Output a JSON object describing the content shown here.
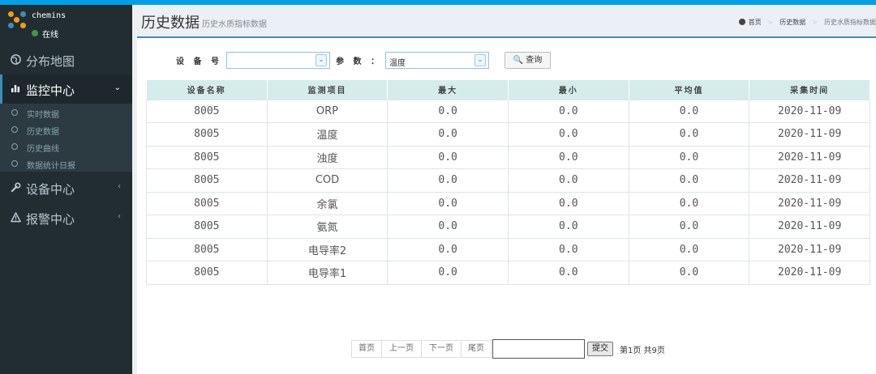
{
  "sidebar": {
    "user": {
      "name": "chemins",
      "status": "在线"
    },
    "menu": [
      {
        "label": "分布地图",
        "icon": "globe-icon"
      },
      {
        "label": "监控中心",
        "icon": "bar-chart-icon"
      },
      {
        "label": "设备中心",
        "icon": "wrench-icon"
      },
      {
        "label": "报警中心",
        "icon": "warning-icon"
      }
    ],
    "submenu": [
      "实时数据",
      "历史数据",
      "历史曲线",
      "数据统计日报"
    ]
  },
  "header": {
    "title": "历史数据",
    "subtitle": "历史水质指标数据",
    "breadcrumb": [
      "首页",
      "历史数据",
      "历史水质指标数据"
    ]
  },
  "filters": {
    "device_label": "设 备 号 ：",
    "device_value": "",
    "param_label": "参  数 ：",
    "param_value": "温度",
    "query_button": "🔍 查询"
  },
  "table": {
    "columns": [
      "设备名称",
      "监测项目",
      "最大",
      "最小",
      "平均值",
      "采集时间"
    ],
    "rows": [
      [
        "8005",
        "ORP",
        "0.0",
        "0.0",
        "0.0",
        "2020-11-09"
      ],
      [
        "8005",
        "温度",
        "0.0",
        "0.0",
        "0.0",
        "2020-11-09"
      ],
      [
        "8005",
        "浊度",
        "0.0",
        "0.0",
        "0.0",
        "2020-11-09"
      ],
      [
        "8005",
        "COD",
        "0.0",
        "0.0",
        "0.0",
        "2020-11-09"
      ],
      [
        "8005",
        "余氯",
        "0.0",
        "0.0",
        "0.0",
        "2020-11-09"
      ],
      [
        "8005",
        "氨氮",
        "0.0",
        "0.0",
        "0.0",
        "2020-11-09"
      ],
      [
        "8005",
        "电导率2",
        "0.0",
        "0.0",
        "0.0",
        "2020-11-09"
      ],
      [
        "8005",
        "电导率1",
        "0.0",
        "0.0",
        "0.0",
        "2020-11-09"
      ]
    ]
  },
  "pager": {
    "first": "首页",
    "prev": "上一页",
    "next": "下一页",
    "last": "尾页",
    "input_value": "",
    "submit": "提交",
    "info": "第1页 共9页"
  },
  "colors": {
    "topbar": "#00a0e9",
    "sidebar": "#222d32",
    "accent": "#3c8dbc",
    "table_header": "#d4ecec",
    "online": "#3c9a3c"
  }
}
